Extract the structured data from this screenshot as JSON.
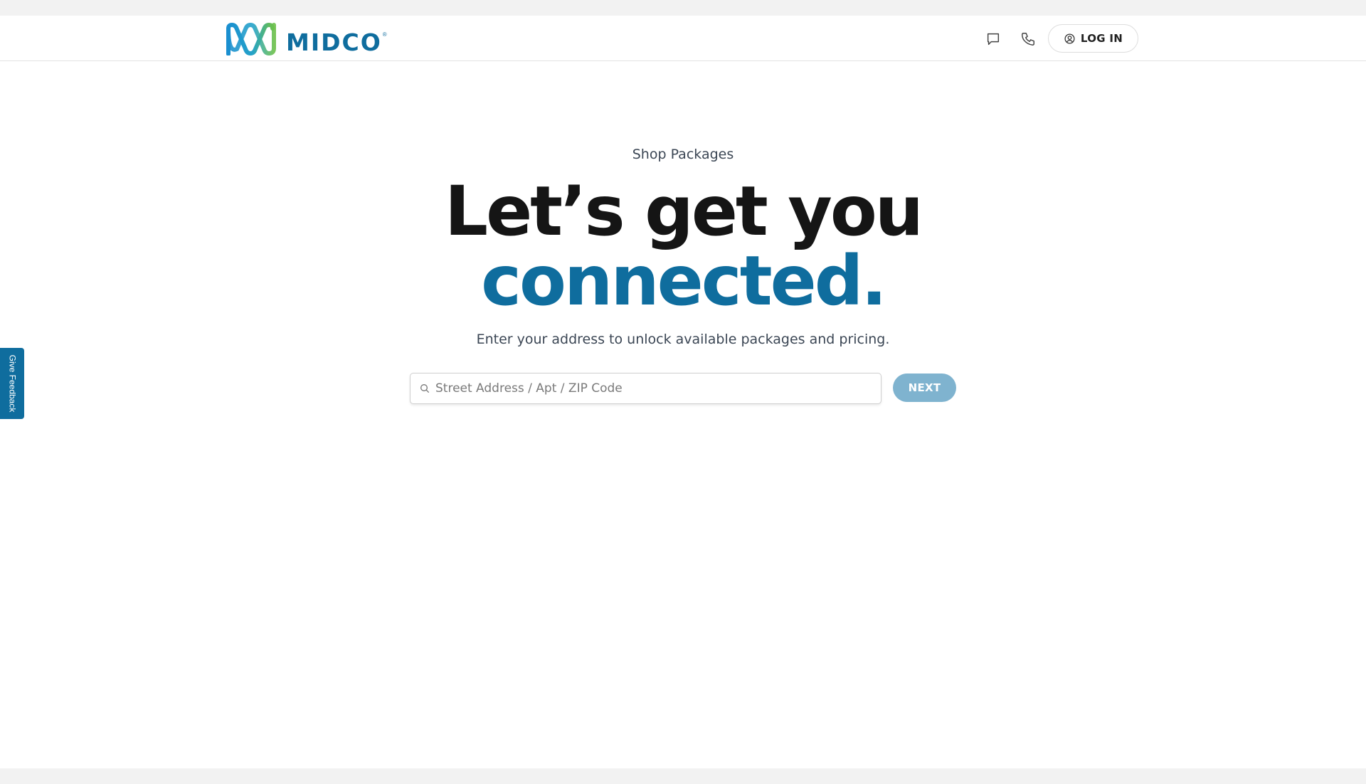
{
  "header": {
    "logo_text": "MIDCO",
    "logo_reg": "®",
    "login_label": "LOG IN",
    "icons": [
      "chat-icon",
      "phone-icon",
      "user-circle-icon"
    ]
  },
  "hero": {
    "eyebrow": "Shop Packages",
    "headline_line1": "Let’s get you",
    "headline_line2": "connected.",
    "subtext": "Enter your address to unlock available packages and pricing."
  },
  "search": {
    "placeholder": "Street Address / Apt / ZIP Code",
    "value": "",
    "button_label": "NEXT"
  },
  "feedback": {
    "label": "Give Feedback"
  },
  "colors": {
    "brand_blue": "#0f6d9e",
    "next_button_disabled": "#7fb3cf",
    "logo_green": "#6cc04a",
    "logo_teal": "#25a3c9"
  }
}
